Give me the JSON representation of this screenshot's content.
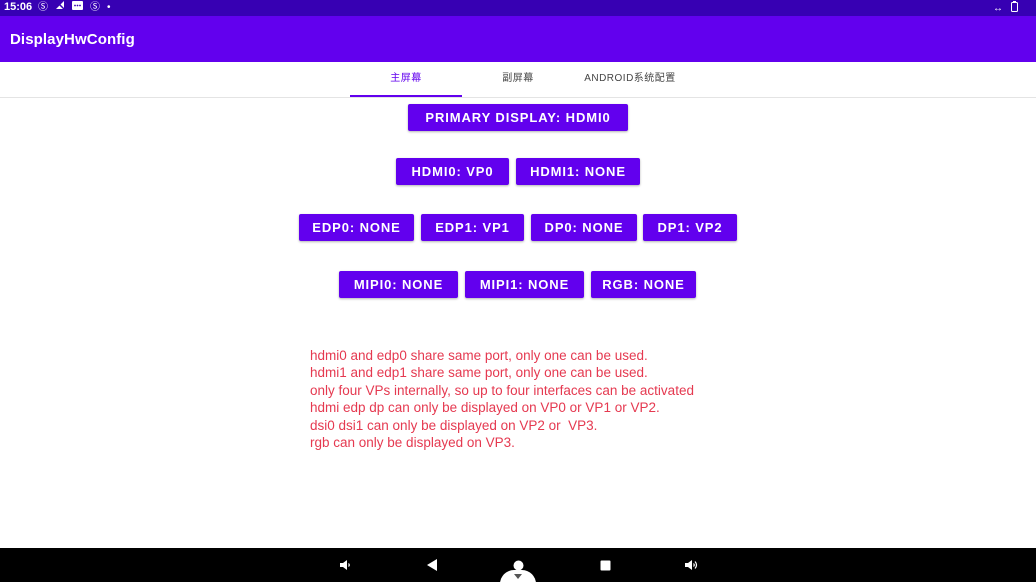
{
  "status_bar": {
    "time": "15:06",
    "icons": [
      "sim-icon",
      "signal-off-icon",
      "message-icon",
      "sim-icon",
      "dot-icon"
    ],
    "right_icons": [
      "data-arrows-icon",
      "battery-icon"
    ]
  },
  "app_bar": {
    "title": "DisplayHwConfig"
  },
  "tabs": [
    {
      "label": "主屏幕",
      "active": true
    },
    {
      "label": "副屏幕",
      "active": false
    },
    {
      "label": "ANDROID系统配置",
      "active": false
    }
  ],
  "buttons": {
    "primary_display": "PRIMARY DISPLAY: HDMI0",
    "hdmi0": "HDMI0: VP0",
    "hdmi1": "HDMI1: NONE",
    "edp0": "EDP0: NONE",
    "edp1": "EDP1: VP1",
    "dp0": "DP0: NONE",
    "dp1": "DP1: VP2",
    "mipi0": "MIPI0: NONE",
    "mipi1": "MIPI1: NONE",
    "rgb": "RGB: NONE"
  },
  "notes": [
    "hdmi0 and edp0 share same port, only one can be used.",
    "hdmi1 and edp1 share same port, only one can be used.",
    "only four VPs internally, so up to four interfaces can be activated",
    "hdmi edp dp can only be displayed on VP0 or VP1 or VP2.",
    "dsi0 dsi1 can only be displayed on VP2 or  VP3.",
    "rgb can only be displayed on VP3."
  ],
  "nav_bar": {
    "icons": [
      "volume-down-icon",
      "back-icon",
      "home-icon",
      "recents-icon",
      "volume-up-icon"
    ]
  },
  "colors": {
    "status_bar": "#3700b3",
    "primary": "#6200ee",
    "notes_text": "#e53950",
    "nav_bar": "#000000"
  }
}
